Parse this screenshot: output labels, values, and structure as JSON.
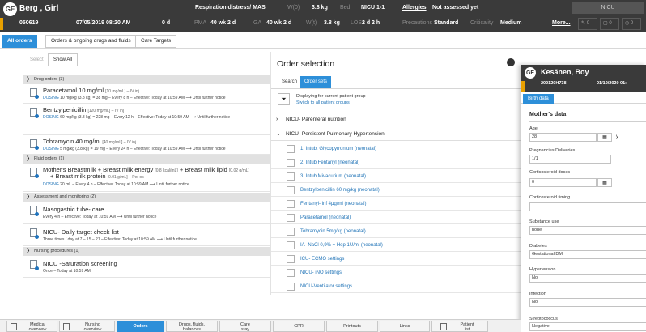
{
  "header": {
    "patient_name": "Berg , Girl",
    "patient_id": "050619",
    "birth_datetime": "07/05/2019 08:20 AM",
    "age": "0 d",
    "diagnosis": "Respiration distress/ MAS",
    "wdob_label": "W(0)",
    "wdob_value": "3.8 kg",
    "bed_label": "Bed",
    "bed_value": "NICU 1-1",
    "allergies_label": "Allergies",
    "allergies_value": "Not assessed yet",
    "unit": "NICU",
    "pma_label": "PMA",
    "pma_value": "40 wk 2 d",
    "ga_label": "GA",
    "ga_value": "40 wk 2 d",
    "wt_label": "W(t)",
    "wt_value": "3.8 kg",
    "los_label": "LOS",
    "los_value": "2 d 2 h",
    "precautions_label": "Precautions",
    "precautions_value": "Standard",
    "criticality_label": "Criticality",
    "criticality_value": "Medium",
    "more_label": "More...",
    "counters": [
      "0",
      "0",
      "0"
    ]
  },
  "top_tabs": [
    "All orders",
    "Orders & ongoing drugs and fluids",
    "Care Targets"
  ],
  "left": {
    "filters": [
      "Select",
      "Show All"
    ],
    "groups": {
      "drug": "Drug orders (3)",
      "fluid": "Fluid orders (1)",
      "assess": "Assessment and monitoring (2)",
      "nursing": "Nursing procedures (1)"
    },
    "orders": [
      {
        "title": "Paracetamol 10 mg/ml",
        "sub": "[10 mg/mL] – IV inj",
        "line1_blue": "DOSING",
        "line1": "10 mg/kg (3.8 kg) = 38 mg – Every 8 h – Effective: Today at 10:59 AM ⟶ Until further notice"
      },
      {
        "title": "Bentzylpenicillin",
        "sub": "[120 mg/mL] – IV inj",
        "line1_blue": "DOSING",
        "line1": "60 mg/kg (3.8 kg) = 228 mg – Every 12 h – Effective: Today at 10:59 AM ⟶ Until further notice"
      },
      {
        "title": "Tobramycin 40 mg/ml",
        "sub": "[40 mg/mL] – IV inj",
        "line1_blue": "DOSING",
        "line1": "5 mg/kg (3.8 kg) = 19 mg – Every 24 h – Effective: Today at 10:59 AM ⟶ Until further notice"
      },
      {
        "title": "Mother's Breastmilk + Breast milk energy",
        "sub": "[0.8 kcal/mL]",
        "title_b": "+ Breast milk lipid",
        "sub_b": "[0.02 g/mL]",
        "title2": "+ Breast milk protein",
        "sub2": "[0.01 g/mL] – Per os",
        "line1_blue": "DOSING",
        "line1": "20 mL – Every 4 h – Effective: Today at 10:59 AM ⟶ Until further notice"
      },
      {
        "title": "Nasogastric tube- care",
        "line1": "Every 4 h – Effective: Today at 10:59 AM ⟶ Until further notice"
      },
      {
        "title": "NICU- Daily target check list",
        "line1": "Three times / day at 7 – 15 – 21 – Effective: Today at 10:59 AM ⟶ Until further notice"
      },
      {
        "title": "NICU -Saturation screening",
        "line1": "Once – Today at 10:59 AM"
      }
    ]
  },
  "order_selection": {
    "title": "Order selection",
    "tabs": [
      "Search",
      "Order sets"
    ],
    "group_text": "Displaying for current patient group",
    "group_link": "Switch to all patient groups",
    "categories": [
      "NICU- Parenteral nutrition",
      "NICU- Persistent Pulmonary Hypertension"
    ],
    "items": [
      "1. Intub. Glycopyrronium (neonatal)",
      "2. Intub Fentanyl (neonatal)",
      "3. Intub Mivacurium (neonatal)",
      "Bentzylpenicillin 60 mg/kg (neonatal)",
      "Fentanyl- inf 4μg/ml (neonatal)",
      "Paracetamol (neonatal)",
      "Tobramycin 5mg/kg (neonatal)",
      "IA- NaCl 0,9% + Hep 1U/ml (neonatal)",
      "ICU- ECMO settings",
      "NICU- iNO settings",
      "NICU-Ventilator settings"
    ]
  },
  "overlay": {
    "name": "Kesänen, Boy",
    "id": "200120H738",
    "date": "01/19/2020 01:",
    "tab": "Birth data",
    "section": "Mother's data",
    "fields": {
      "age_label": "Age",
      "age_value": "28",
      "age_unit": "y",
      "preg_label": "Pregnancies/Deliveries",
      "preg_value": "1/1",
      "cortdose_label": "Corticosteroid doses",
      "cortdose_value": "0",
      "cortime_label": "Corticosteroid timing",
      "subst_label": "Substance use",
      "subst_value": "none",
      "diab_label": "Diabetes",
      "diab_value": "Gestational DM",
      "hyper_label": "Hypertension",
      "hyper_value": "No",
      "inf_label": "Infection",
      "inf_value": "No",
      "strep_label": "Streptococcus",
      "strep_value": "Negative"
    }
  },
  "bottom_nav": [
    {
      "label": "Medical overview",
      "l1": "Medical",
      "l2": "overview"
    },
    {
      "label": "Nursing overview",
      "l1": "Nursing",
      "l2": "overview"
    },
    {
      "label": "Orders"
    },
    {
      "label": "Drugs, fluids, balances",
      "l1": "Drugs, fluids,",
      "l2": "balances"
    },
    {
      "label": "Care stay",
      "l1": "Care",
      "l2": "stay"
    },
    {
      "label": "CPR"
    },
    {
      "label": "Printouts"
    },
    {
      "label": "Links"
    },
    {
      "label": "Patient list",
      "l1": "Patient",
      "l2": "list"
    }
  ],
  "colors": {
    "accent": "#2d8fd9",
    "header_bg": "#3a3a3a",
    "link": "#1f73b7",
    "flag": "#e8a000"
  }
}
